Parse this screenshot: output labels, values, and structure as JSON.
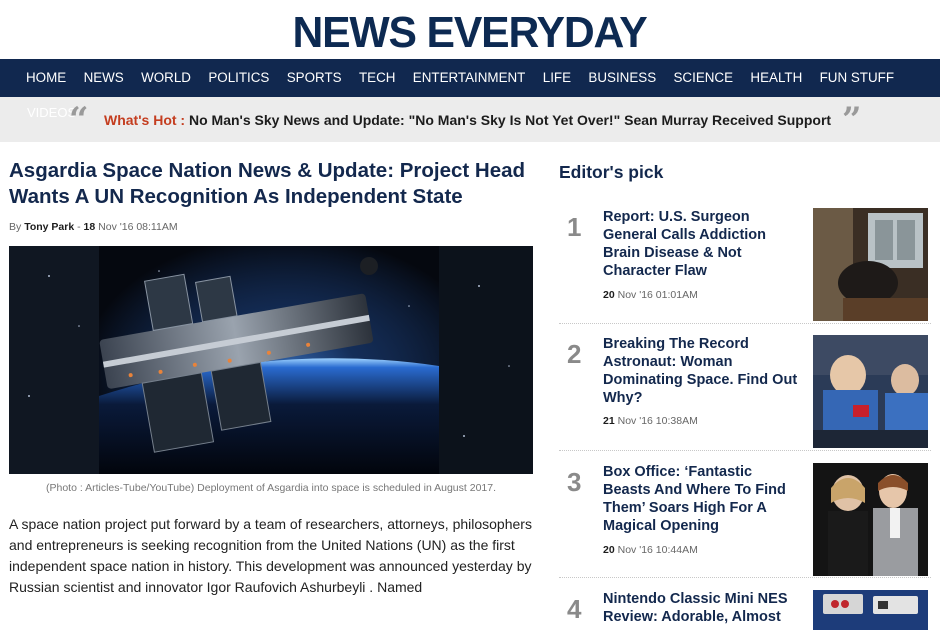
{
  "site": {
    "logo": "NEWS EVERYDAY"
  },
  "nav": {
    "items": [
      "HOME",
      "NEWS",
      "WORLD",
      "POLITICS",
      "SPORTS",
      "TECH",
      "ENTERTAINMENT",
      "LIFE",
      "BUSINESS",
      "SCIENCE",
      "HEALTH",
      "FUN STUFF"
    ],
    "overflow_item": "VIDEOS"
  },
  "hot": {
    "label": "What's Hot :",
    "text": "No Man's Sky News and Update: \"No Man's Sky Is Not Yet Over!\" Sean Murray Received Support"
  },
  "article": {
    "title": "Asgardia Space Nation News & Update: Project Head Wants A UN Recognition As Independent State",
    "by_prefix": "By",
    "author": "Tony Park",
    "date_sep": "-",
    "date_day": "18",
    "date_rest": "Nov '16 08:11AM",
    "caption": "(Photo : Articles-Tube/YouTube) Deployment of Asgardia into space is scheduled in August 2017.",
    "body": "A space nation project put forward by a team of researchers, attorneys, philosophers and entrepreneurs is seeking recognition from the United Nations (UN) as the first independent space nation in history. This development was announced yesterday by Russian scientist and innovator Igor Raufovich Ashurbeyli . Named"
  },
  "sidebar": {
    "title": "Editor's pick",
    "picks": [
      {
        "num": "1",
        "title": "Report: U.S. Surgeon General Calls Addiction Brain Disease & Not Character Flaw",
        "day": "20",
        "date_rest": "Nov '16 01:01AM"
      },
      {
        "num": "2",
        "title": "Breaking The Record Astronaut: Woman Dominating Space. Find Out Why?",
        "day": "21",
        "date_rest": "Nov '16 10:38AM"
      },
      {
        "num": "3",
        "title": "Box Office: ‘Fantastic Beasts And Where To Find Them’ Soars High For A Magical Opening",
        "day": "20",
        "date_rest": "Nov '16 10:44AM"
      },
      {
        "num": "4",
        "title": "Nintendo Classic Mini NES Review: Adorable, Almost",
        "day": "",
        "date_rest": ""
      }
    ]
  },
  "colors": {
    "navy": "#11284f",
    "hot_red": "#c43d1f",
    "hotbar_bg": "#ececec"
  }
}
